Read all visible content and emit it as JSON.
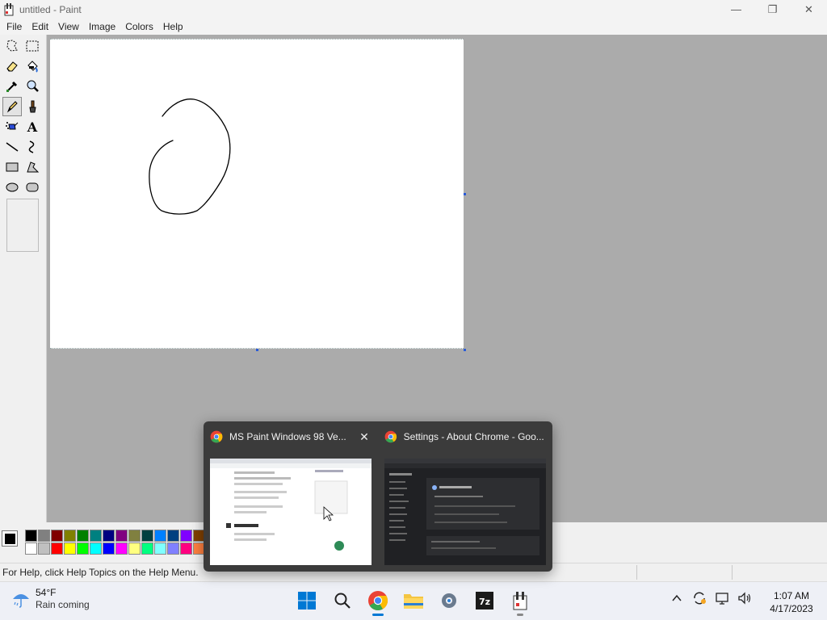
{
  "window": {
    "title": "untitled - Paint",
    "controls": {
      "minimize": "—",
      "restore": "❐",
      "close": "✕"
    }
  },
  "menubar": {
    "items": [
      "File",
      "Edit",
      "View",
      "Image",
      "Colors",
      "Help"
    ]
  },
  "toolbox": {
    "tools": [
      "free-form-select",
      "select",
      "eraser",
      "fill-with-color",
      "pick-color",
      "magnifier",
      "pencil",
      "brush",
      "airbrush",
      "text",
      "line",
      "curve",
      "rectangle",
      "polygon",
      "ellipse",
      "rounded-rectangle"
    ],
    "selected": "pencil",
    "text_tool_glyph": "A"
  },
  "palette": {
    "current_foreground": "#000000",
    "current_background": "#ffffff",
    "row1": [
      "#000000",
      "#808080",
      "#800000",
      "#808000",
      "#008000",
      "#008080",
      "#000080",
      "#800080",
      "#808040",
      "#004040",
      "#0080ff",
      "#004080",
      "#8000ff",
      "#804000",
      "#804000"
    ],
    "row2": [
      "#ffffff",
      "#c0c0c0",
      "#ff0000",
      "#ffff00",
      "#00ff00",
      "#00ffff",
      "#0000ff",
      "#ff00ff",
      "#ffff80",
      "#00ff80",
      "#80ffff",
      "#8080ff",
      "#ff0080",
      "#ff8040",
      "#ff8040"
    ]
  },
  "statusbar": {
    "text": "For Help, click Help Topics on the Help Menu."
  },
  "taskbar": {
    "weather": {
      "temp": "54°F",
      "desc": "Rain coming"
    },
    "apps": [
      "windows-start",
      "search",
      "google-chrome",
      "file-explorer",
      "settings",
      "7-zip",
      "paint"
    ],
    "clock": {
      "time": "1:07 AM",
      "date": "4/17/2023"
    }
  },
  "previews": [
    {
      "title": "MS Paint Windows 98 Ve...",
      "close": "✕"
    },
    {
      "title": "Settings - About Chrome - Goo..."
    }
  ],
  "colors": {
    "accent": "#0078d4",
    "chrome_red": "#ea4335",
    "chrome_green": "#34a853",
    "chrome_yellow": "#fbbc05",
    "chrome_blue": "#4285f4"
  }
}
